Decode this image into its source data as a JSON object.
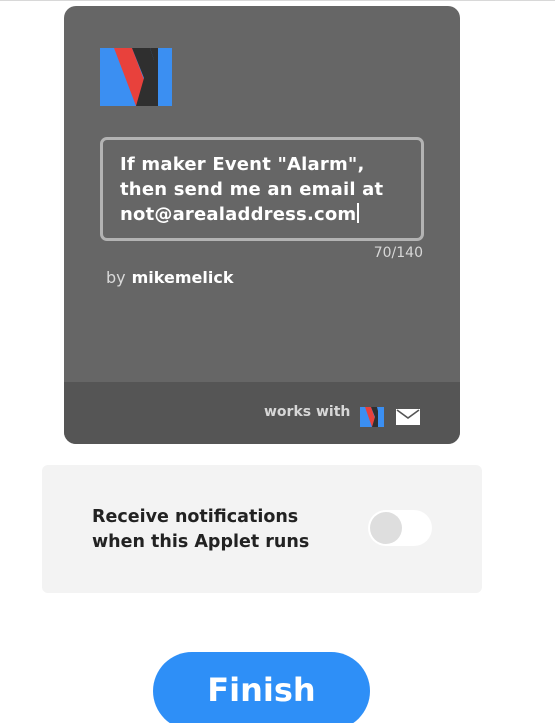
{
  "applet": {
    "service_icon": "maker-webhooks-logo",
    "description": "If maker Event \"Alarm\", then send me an email at not@arealaddress.com",
    "char_count": "70/140",
    "by_prefix": "by",
    "author": "mikemelick",
    "works_with_label": "works with",
    "works_with_icons": [
      "maker-webhooks-logo",
      "email-envelope-icon"
    ]
  },
  "notifications": {
    "label": "Receive notifications when this Applet runs",
    "enabled": false
  },
  "finish_button": {
    "label": "Finish"
  },
  "colors": {
    "card_bg": "#666666",
    "card_footer_bg": "#555555",
    "brand_blue": "#2e8ff7",
    "maker_red": "#e8413c",
    "maker_blue": "#3b8ff2",
    "panel_bg": "#f3f3f3"
  }
}
